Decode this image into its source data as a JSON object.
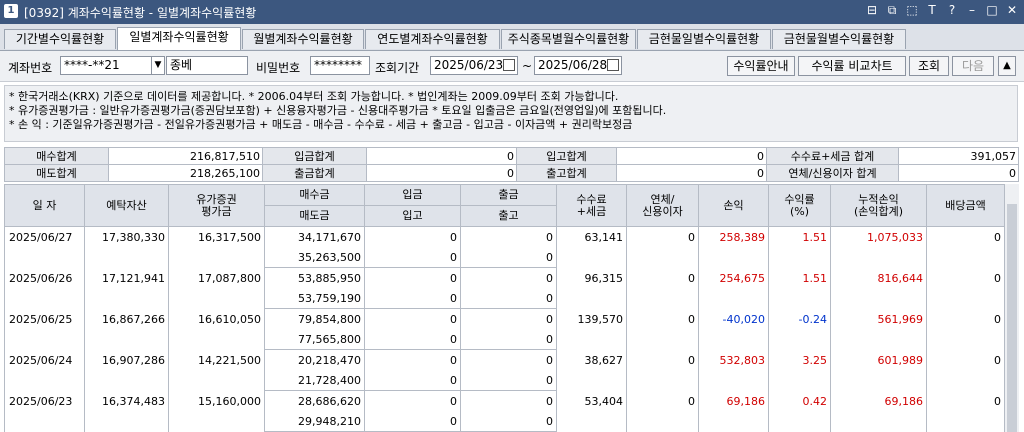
{
  "titlebar": {
    "window_number": "1",
    "title": "[0392] 계좌수익률현황 - 일별계좌수익률현황",
    "controls": [
      "⊟",
      "⧉",
      "⬚",
      "T",
      "?",
      "–",
      "□",
      "✕"
    ]
  },
  "tabs": [
    {
      "label": "기간별수익률현황"
    },
    {
      "label": "일별계좌수익률현황"
    },
    {
      "label": "월별계좌수익률현황"
    },
    {
      "label": "연도별계좌수익률현황"
    },
    {
      "label": "주식종목별월수익률현황"
    },
    {
      "label": "금현물일별수익률현황"
    },
    {
      "label": "금현물월별수익률현황"
    }
  ],
  "search": {
    "account_label": "계좌번호",
    "account_value": "****-**21",
    "account_type": "종베",
    "password_label": "비밀번호",
    "password_value": "********",
    "period_label": "조회기간",
    "start_date": "2025/06/23",
    "tilde": "~",
    "end_date": "2025/06/28",
    "btn_guide": "수익률안내",
    "btn_compare": "수익률 비교차트",
    "btn_search": "조회",
    "btn_next": "다음",
    "btn_up": "▲"
  },
  "info_lines": [
    "* 한국거래소(KRX) 기준으로 데이터를 제공합니다.  * 2006.04부터 조회 가능합니다.  * 법인계좌는 2009.09부터 조회 가능합니다.",
    "* 유가증권평가금 : 일반유가증권평가금(증권담보포함) + 신용융자평가금 - 신용대주평가금  * 토요일 입출금은 금요일(전영업일)에 포함됩니다.",
    "* 손        익 : 기준일유가증권평가금 - 전일유가증권평가금 + 매도금 - 매수금 - 수수료 - 세금 + 출고금 - 입고금 - 이자금액 + 권리락보정금"
  ],
  "summary": {
    "buy_total_label": "매수합계",
    "buy_total": "216,817,510",
    "deposit_total_label": "입금합계",
    "deposit_total": "0",
    "in_total_label": "입고합계",
    "in_total": "0",
    "fee_tax_label": "수수료+세금 합계",
    "fee_tax_total": "391,057",
    "sell_total_label": "매도합계",
    "sell_total": "218,265,100",
    "withdraw_total_label": "출금합계",
    "withdraw_total": "0",
    "out_total_label": "출고합계",
    "out_total": "0",
    "overdue_label": "연체/신용이자 합계",
    "overdue_total": "0"
  },
  "grid": {
    "headers": {
      "date": "일 자",
      "deposit_asset": "예탁자산",
      "securities_eval_1": "유가증권",
      "securities_eval_2": "평가금",
      "buy": "매수금",
      "sell": "매도금",
      "deposit": "입금",
      "in": "입고",
      "withdraw": "출금",
      "out": "출고",
      "fee_1": "수수료",
      "fee_2": "+세금",
      "overdue_1": "연체/",
      "overdue_2": "신용이자",
      "pnl": "손익",
      "rate_1": "수익률",
      "rate_2": "(%)",
      "cum_1": "누적손익",
      "cum_2": "(손익합계)",
      "dividend": "배당금액"
    },
    "rows": [
      {
        "date": "2025/06/27",
        "deposit_asset": "17,380,330",
        "securities_eval": "16,317,500",
        "buy": "34,171,670",
        "sell": "35,263,500",
        "deposit": "0",
        "in": "0",
        "withdraw": "0",
        "out": "0",
        "fee_tax": "63,141",
        "overdue": "0",
        "pnl": "258,389",
        "rate": "1.51",
        "cum": "1,075,033",
        "dividend": "0"
      },
      {
        "date": "2025/06/26",
        "deposit_asset": "17,121,941",
        "securities_eval": "17,087,800",
        "buy": "53,885,950",
        "sell": "53,759,190",
        "deposit": "0",
        "in": "0",
        "withdraw": "0",
        "out": "0",
        "fee_tax": "96,315",
        "overdue": "0",
        "pnl": "254,675",
        "rate": "1.51",
        "cum": "816,644",
        "dividend": "0"
      },
      {
        "date": "2025/06/25",
        "deposit_asset": "16,867,266",
        "securities_eval": "16,610,050",
        "buy": "79,854,800",
        "sell": "77,565,800",
        "deposit": "0",
        "in": "0",
        "withdraw": "0",
        "out": "0",
        "fee_tax": "139,570",
        "overdue": "0",
        "pnl": "-40,020",
        "rate": "-0.24",
        "cum": "561,969",
        "dividend": "0"
      },
      {
        "date": "2025/06/24",
        "deposit_asset": "16,907,286",
        "securities_eval": "14,221,500",
        "buy": "20,218,470",
        "sell": "21,728,400",
        "deposit": "0",
        "in": "0",
        "withdraw": "0",
        "out": "0",
        "fee_tax": "38,627",
        "overdue": "0",
        "pnl": "532,803",
        "rate": "3.25",
        "cum": "601,989",
        "dividend": "0"
      },
      {
        "date": "2025/06/23",
        "deposit_asset": "16,374,483",
        "securities_eval": "15,160,000",
        "buy": "28,686,620",
        "sell": "29,948,210",
        "deposit": "0",
        "in": "0",
        "withdraw": "0",
        "out": "0",
        "fee_tax": "53,404",
        "overdue": "0",
        "pnl": "69,186",
        "rate": "0.42",
        "cum": "69,186",
        "dividend": "0"
      }
    ]
  },
  "colors": {
    "titlebar": "#3c577f",
    "positive": "#d10000",
    "negative": "#0033cc"
  }
}
